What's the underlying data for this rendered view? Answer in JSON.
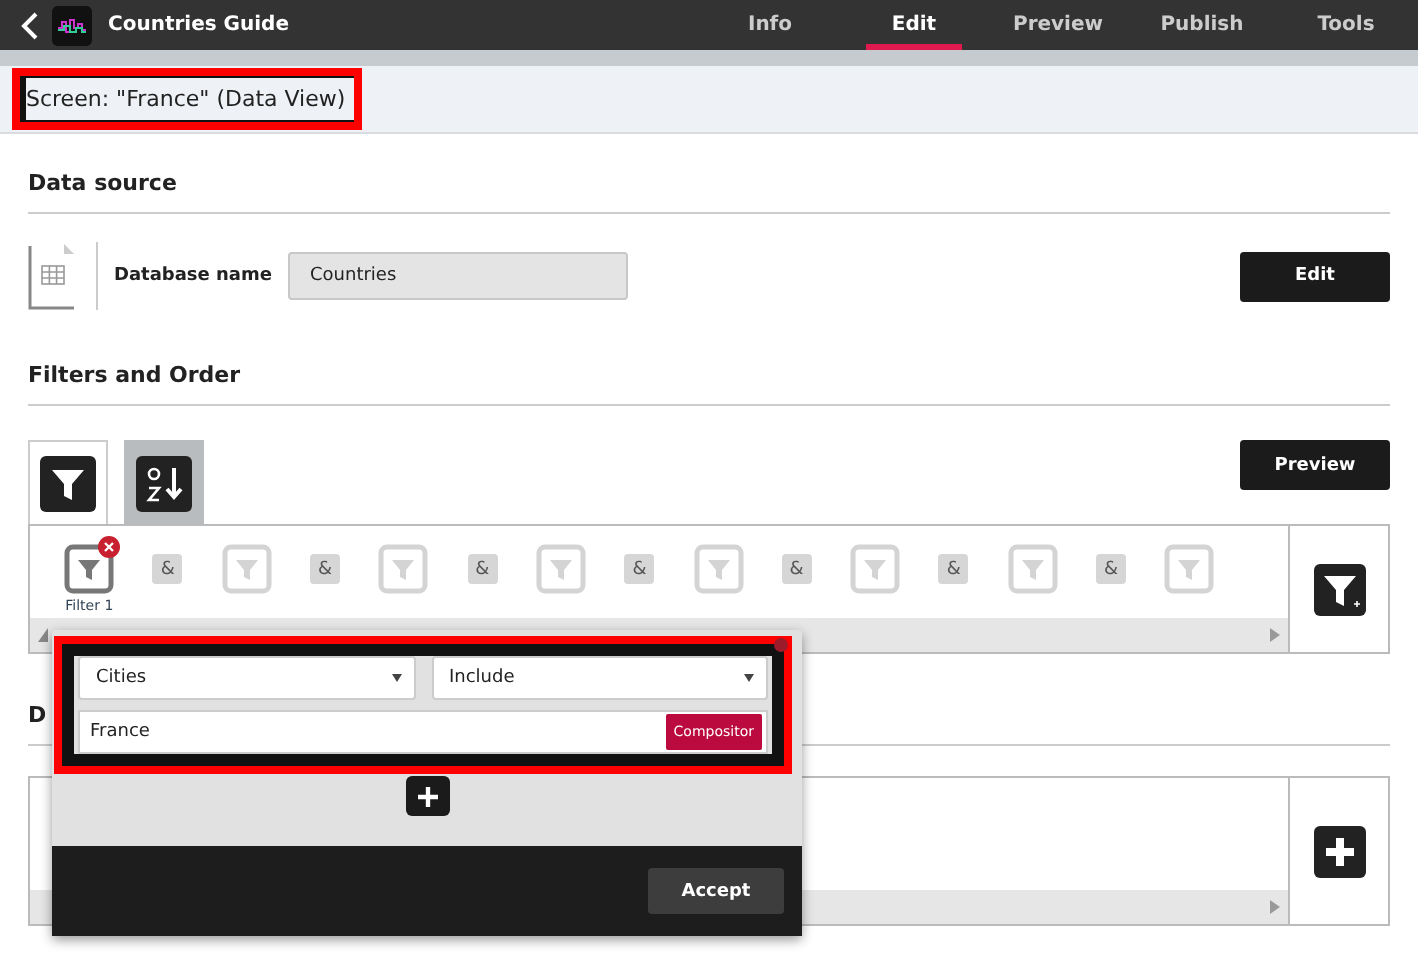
{
  "app_bar": {
    "title": "Countries Guide",
    "tabs": [
      {
        "label": "Info",
        "selected": false
      },
      {
        "label": "Edit",
        "selected": true
      },
      {
        "label": "Preview",
        "selected": false
      },
      {
        "label": "Publish",
        "selected": false
      },
      {
        "label": "Tools",
        "selected": false
      }
    ]
  },
  "screen_title": {
    "text": "Screen: \"France\" (Data View)",
    "highlighted": true
  },
  "data_source": {
    "heading": "Data source",
    "label": "Database name",
    "value": "Countries",
    "button": "Edit"
  },
  "filters": {
    "heading": "Filters and Order",
    "tabs": [
      {
        "kind": "filter",
        "selected": true
      },
      {
        "kind": "sort",
        "selected": false
      }
    ],
    "button": "Preview",
    "items": [
      {
        "kind": "filter",
        "active": true,
        "label": "Filter 1"
      },
      {
        "kind": "and",
        "text": "&"
      },
      {
        "kind": "filter",
        "active": false
      },
      {
        "kind": "and",
        "text": "&"
      },
      {
        "kind": "filter",
        "active": false
      },
      {
        "kind": "and",
        "text": "&"
      },
      {
        "kind": "filter",
        "active": false
      },
      {
        "kind": "and",
        "text": "&"
      },
      {
        "kind": "filter",
        "active": false
      },
      {
        "kind": "and",
        "text": "&"
      },
      {
        "kind": "filter",
        "active": false
      },
      {
        "kind": "and",
        "text": "&"
      },
      {
        "kind": "filter",
        "active": false
      },
      {
        "kind": "and",
        "text": "&"
      },
      {
        "kind": "filter",
        "active": false
      }
    ]
  },
  "section_3": {
    "heading": "D"
  },
  "filter_popup": {
    "field": "Cities",
    "operator": "Include",
    "value": "France",
    "value_button": "Compositor",
    "highlighted": true,
    "button": "Accept"
  }
}
